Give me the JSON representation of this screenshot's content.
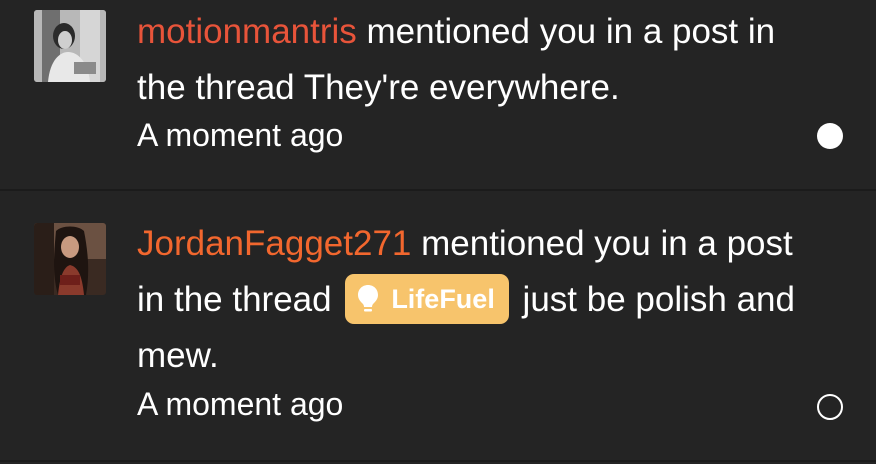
{
  "notifications": [
    {
      "username": "motionmantris",
      "action_text": " mentioned you in a post in the thread They're everywhere.",
      "timestamp": "A moment ago",
      "unread": true,
      "avatar_icon": "user-avatar-photo"
    },
    {
      "username": "JordanFagget271",
      "action_text_before": " mentioned you in a post in the thread ",
      "thread_tag": {
        "label": "LifeFuel",
        "icon": "lightbulb-icon",
        "color": "#f7c46c"
      },
      "action_text_after": " just be polish and mew.",
      "timestamp": "A moment ago",
      "unread": false,
      "avatar_icon": "user-avatar-photo"
    }
  ],
  "colors": {
    "background": "#242424",
    "username_1": "#e8543a",
    "username_2": "#f2672e",
    "text": "#ffffff"
  }
}
